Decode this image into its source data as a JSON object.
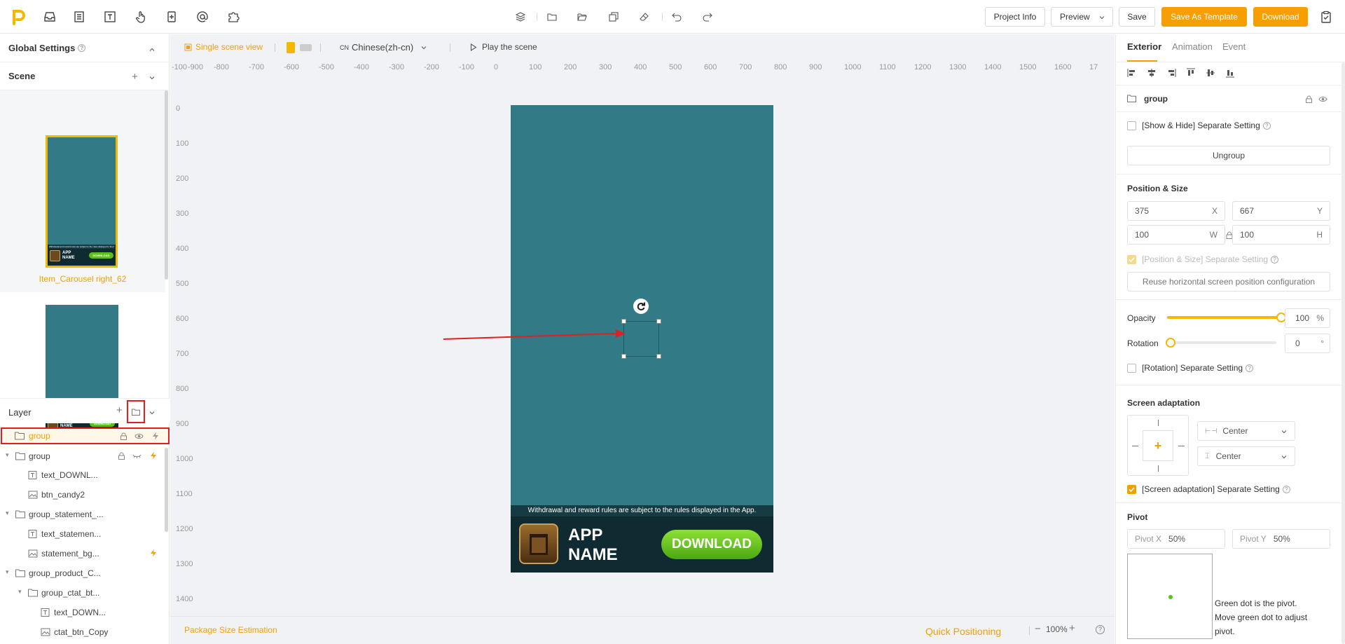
{
  "toolbar": {
    "project_info": "Project Info",
    "preview": "Preview",
    "save": "Save",
    "save_template": "Save As Template",
    "download": "Download"
  },
  "left": {
    "global_settings": "Global Settings",
    "scene_title": "Scene",
    "scene_card_label": "Item_Carousel right_62",
    "layer_title": "Layer",
    "thumb_app_name": "APP NAME",
    "thumb_download": "DOWNLOAD",
    "thumb_banner": "Withdrawal and reward rules are subject to the rules displayed in the App.",
    "layers": [
      {
        "label": "group"
      },
      {
        "label": "group"
      },
      {
        "label": "text_DOWNL..."
      },
      {
        "label": "btn_candy2"
      },
      {
        "label": "group_statement_..."
      },
      {
        "label": "text_statemen..."
      },
      {
        "label": "statement_bg..."
      },
      {
        "label": "group_product_C..."
      },
      {
        "label": "group_ctat_bt..."
      },
      {
        "label": "text_DOWN..."
      },
      {
        "label": "ctat_btn_Copy"
      }
    ]
  },
  "canvas": {
    "single_scene": "Single scene view",
    "language": "Chinese(zh-cn)",
    "language_prefix": "CN",
    "play": "Play the scene",
    "ruler_h": [
      "-100",
      "-900",
      "-800",
      "-700",
      "-600",
      "-500",
      "-400",
      "-300",
      "-200",
      "-100",
      "0",
      "100",
      "200",
      "300",
      "400",
      "500",
      "600",
      "700",
      "800",
      "900",
      "1000",
      "1100",
      "1200",
      "1300",
      "1400",
      "1500",
      "1600",
      "17"
    ],
    "ruler_v": [
      "0",
      "100",
      "200",
      "300",
      "400",
      "500",
      "600",
      "700",
      "800",
      "900",
      "1000",
      "1100",
      "1200",
      "1300",
      "1400"
    ],
    "banner_text": "Withdrawal and reward rules are subject to the rules displayed in the App.",
    "app_name_line1": "APP",
    "app_name_line2": "NAME",
    "download_btn": "DOWNLOAD",
    "package_size": "Package Size Estimation",
    "quick_positioning": "Quick Positioning",
    "zoom": "100%",
    "zoom_minus": "−",
    "zoom_plus": "+"
  },
  "right": {
    "tabs": [
      "Exterior",
      "Animation",
      "Event"
    ],
    "element_name": "group",
    "show_hide": "[Show & Hide]  Separate Setting",
    "ungroup": "Ungroup",
    "position_size": "Position & Size",
    "x_value": "375",
    "x_label": "X",
    "y_value": "667",
    "y_label": "Y",
    "w_value": "100",
    "w_label": "W",
    "h_value": "100",
    "h_label": "H",
    "pos_separate": "[Position & Size] Separate Setting",
    "reuse_horizontal": "Reuse horizontal screen position configuration",
    "opacity_label": "Opacity",
    "opacity_value": "100",
    "opacity_fraction": 1.0,
    "opacity_unit": "%",
    "rotation_label": "Rotation",
    "rotation_value": "0",
    "rotation_unit": "°",
    "rotation_separate": "[Rotation] Separate Setting",
    "screen_adaptation": "Screen adaptation",
    "h_align": "Center",
    "v_align": "Center",
    "screen_separate": "[Screen adaptation] Separate Setting",
    "pivot": "Pivot",
    "pivot_x_label": "Pivot X",
    "pivot_x_value": "50%",
    "pivot_y_label": "Pivot Y",
    "pivot_y_value": "50%",
    "pivot_hint_1": "Green dot is the pivot.",
    "pivot_hint_2": "Move green dot to adjust",
    "pivot_hint_3": "pivot."
  },
  "colors": {
    "accent": "#f5a000",
    "phone_bg": "#327a85",
    "highlight_red": "#e02020",
    "download_green": "#5cc01a"
  }
}
